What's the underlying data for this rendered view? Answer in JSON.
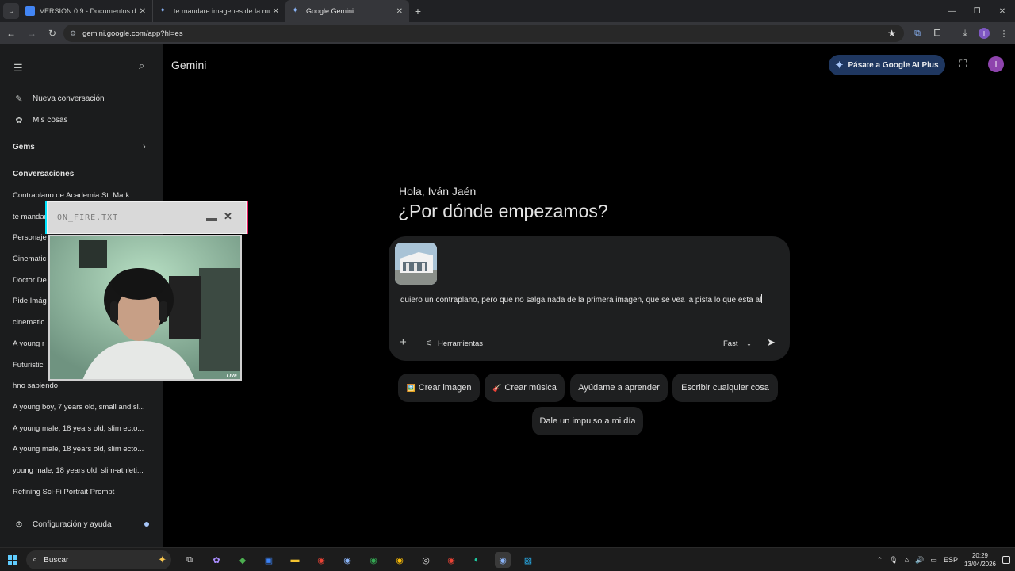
{
  "browser": {
    "tabs": [
      {
        "title": "VERSION 0.9 - Documentos de",
        "favicon_color": "#4285f4",
        "active": false
      },
      {
        "title": "te mandare imagenes de la mu",
        "favicon_color": "#8ab4f8",
        "active": false
      },
      {
        "title": "Google Gemini",
        "favicon_color": "#8ab4f8",
        "active": true
      }
    ],
    "url": "gemini.google.com/app?hl=es"
  },
  "sidebar": {
    "new_chat": "Nueva conversación",
    "my_stuff": "Mis cosas",
    "gems": "Gems",
    "conversations_header": "Conversaciones",
    "conversations": [
      "Contraplano de Academia St. Mark",
      "te mandare imagenes de la mu",
      "Personaje",
      "Cinematic",
      "Doctor De",
      "Pide Imág",
      "cinematic",
      "A young r",
      "Futuristic",
      "hno sabiendo",
      "A young boy, 7 years old, small and sl...",
      "A young male, 18 years old, slim ecto...",
      "A young male, 18 years old, slim ecto...",
      "young male, 18 years old, slim-athleti...",
      "Refining Sci-Fi Portrait Prompt"
    ],
    "settings": "Configuración y ayuda"
  },
  "main": {
    "app_title": "Gemini",
    "upgrade_label": "Pásate a Google AI Plus",
    "avatar_letter": "I",
    "greeting": "Hola, Iván Jaén",
    "headline": "¿Por dónde empezamos?",
    "prompt_text": "quiero un contraplano, pero que no salga nada de la primera imagen, que se vea la pista lo que esta al",
    "tools_label": "Herramientas",
    "model_label": "Fast",
    "chips": [
      {
        "label": "Crear imagen",
        "emoji": "🖼️"
      },
      {
        "label": "Crear música",
        "emoji": "🎸"
      },
      {
        "label": "Ayúdame a aprender",
        "emoji": ""
      },
      {
        "label": "Escribir cualquier cosa",
        "emoji": ""
      },
      {
        "label": "Dale un impulso a mi día",
        "emoji": ""
      }
    ]
  },
  "webcam": {
    "title": "ON_FIRE.TXT",
    "live": "LIVE"
  },
  "taskbar": {
    "search_placeholder": "Buscar",
    "language": "ESP",
    "time": "20:29",
    "date": "13/04/2026"
  }
}
